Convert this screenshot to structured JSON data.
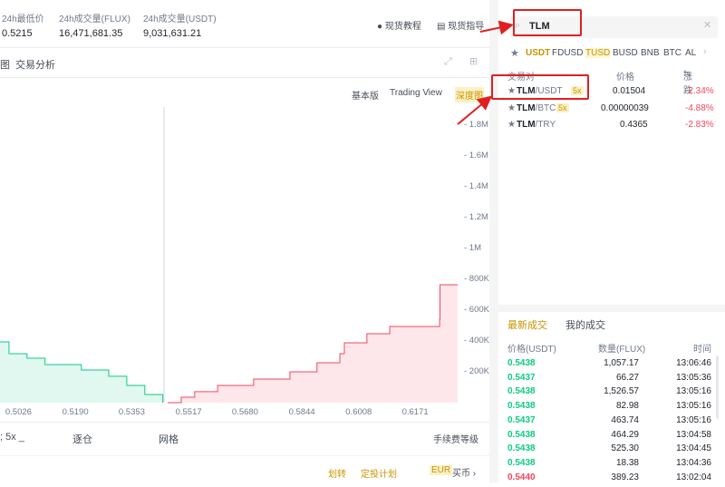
{
  "stats": [
    {
      "label": "24h最低价",
      "value": "0.5215"
    },
    {
      "label": "24h成交量(FLUX)",
      "value": "16,471,681.35"
    },
    {
      "label": "24h成交量(USDT)",
      "value": "9,031,631.21"
    }
  ],
  "header_links": {
    "tutorial": "现货教程",
    "guide": "现货指导"
  },
  "tabs": {
    "partial": "图",
    "analysis": "交易分析"
  },
  "chart_views": {
    "basic": "基本版",
    "tradingview": "Trading View",
    "depth": "深度图"
  },
  "search": {
    "value": "TLM"
  },
  "quote_tabs": [
    "USDT",
    "FDUSD",
    "TUSD",
    "BUSD",
    "BNB",
    "BTC",
    "AL"
  ],
  "pairs_header": {
    "pair": "交易对",
    "price": "价格",
    "change": "涨跌"
  },
  "pairs": [
    {
      "base": "TLM",
      "quote": "/USDT",
      "leverage": "5x",
      "price": "0.01504",
      "change": "-2.34%"
    },
    {
      "base": "TLM",
      "quote": "/BTC",
      "leverage": "5x",
      "price": "0.00000039",
      "change": "-4.88%"
    },
    {
      "base": "TLM",
      "quote": "/TRY",
      "leverage": "",
      "price": "0.4365",
      "change": "-2.83%"
    }
  ],
  "trades_tabs": {
    "latest": "最新成交",
    "mine": "我的成交"
  },
  "trades_header": {
    "price": "价格(USDT)",
    "amount": "数量(FLUX)",
    "time": "时间"
  },
  "trades": [
    {
      "price": "0.5438",
      "amount": "1,057.17",
      "time": "13:06:46",
      "side": "buy"
    },
    {
      "price": "0.5437",
      "amount": "66.27",
      "time": "13:05:36",
      "side": "buy"
    },
    {
      "price": "0.5438",
      "amount": "1,526.57",
      "time": "13:05:16",
      "side": "buy"
    },
    {
      "price": "0.5438",
      "amount": "82.98",
      "time": "13:05:16",
      "side": "buy"
    },
    {
      "price": "0.5437",
      "amount": "463.74",
      "time": "13:05:16",
      "side": "buy"
    },
    {
      "price": "0.5438",
      "amount": "464.29",
      "time": "13:04:58",
      "side": "buy"
    },
    {
      "price": "0.5438",
      "amount": "525.30",
      "time": "13:04:45",
      "side": "buy"
    },
    {
      "price": "0.5438",
      "amount": "18.38",
      "time": "13:04:36",
      "side": "buy"
    },
    {
      "price": "0.5440",
      "amount": "389.23",
      "time": "13:02:04",
      "side": "sell"
    }
  ],
  "order_tabs": {
    "leverage": "5x",
    "isolated": "逐仓",
    "grid": "网格",
    "fee": "手续费等级"
  },
  "footer": {
    "transfer": "划转",
    "plan": "定投计划",
    "currency": "EUR",
    "buy": "买币"
  },
  "colors": {
    "bid": "#0ecb81",
    "ask": "#f6465d",
    "accent": "#c99400",
    "annotation": "#e02020"
  },
  "chart_data": {
    "type": "area",
    "title": "深度图",
    "x_ticks": [
      "0.5026",
      "0.5190",
      "0.5353",
      "0.5517",
      "0.5680",
      "0.5844",
      "0.6008",
      "0.6171"
    ],
    "y_ticks": [
      "200K",
      "400K",
      "600K",
      "800K",
      "1M",
      "1.2M",
      "1.4M",
      "1.6M",
      "1.8M"
    ],
    "xlim": [
      0.4974,
      0.6295
    ],
    "ylim": [
      0,
      1900000
    ],
    "series": [
      {
        "name": "bids",
        "points": [
          [
            0.4974,
            394000
          ],
          [
            0.5,
            318000
          ],
          [
            0.5052,
            288000
          ],
          [
            0.5104,
            247000
          ],
          [
            0.5209,
            212000
          ],
          [
            0.5288,
            171000
          ],
          [
            0.534,
            112000
          ],
          [
            0.5392,
            53000
          ],
          [
            0.5444,
            0
          ]
        ]
      },
      {
        "name": "asks",
        "points": [
          [
            0.5458,
            0
          ],
          [
            0.5497,
            35000
          ],
          [
            0.5536,
            71000
          ],
          [
            0.5602,
            112000
          ],
          [
            0.5706,
            153000
          ],
          [
            0.5811,
            200000
          ],
          [
            0.5889,
            259000
          ],
          [
            0.5955,
            318000
          ],
          [
            0.5968,
            388000
          ],
          [
            0.6033,
            447000
          ],
          [
            0.6099,
            494000
          ],
          [
            0.6243,
            541000
          ],
          [
            0.6244,
            765000
          ],
          [
            0.6295,
            765000
          ]
        ]
      }
    ]
  }
}
